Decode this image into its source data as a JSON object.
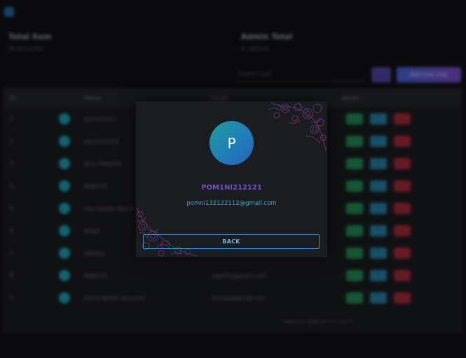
{
  "background": {
    "stats": [
      {
        "value": "Total Sum",
        "sub": "All Accounts"
      },
      {
        "value": "Admin Total",
        "sub": "In Service"
      }
    ],
    "search_placeholder": "Search user",
    "add_button_label": "Add new user",
    "table": {
      "headers": [
        "ID",
        "Name",
        "Email",
        "Action"
      ],
      "rows": [
        {
          "id": "1",
          "name": "pomni1212"
        },
        {
          "id": "2",
          "name": "pomni12121"
        },
        {
          "id": "3",
          "name": "Kuro Tester01"
        },
        {
          "id": "4",
          "name": "Night Fu"
        },
        {
          "id": "5",
          "name": "Lee master Name"
        },
        {
          "id": "6",
          "name": "Angel"
        },
        {
          "id": "7",
          "name": "Hellboy"
        },
        {
          "id": "8",
          "name": "Night Fu",
          "email": "nightfu@gmail.com"
        },
        {
          "id": "9",
          "name": "Fuma Winter Account",
          "email": "fumaw@gmail.com"
        }
      ],
      "footer": "Rows per page   10 ▾   1–9 of 9"
    }
  },
  "modal": {
    "avatar_initial": "P",
    "username": "POM1NI212121",
    "email": "pomni132122112@gmail.com",
    "back_label": "BACK"
  },
  "colors": {
    "accent_purple": "#7a4fd0",
    "accent_blue": "#3c86c9",
    "email_teal": "#3fa2c8"
  }
}
